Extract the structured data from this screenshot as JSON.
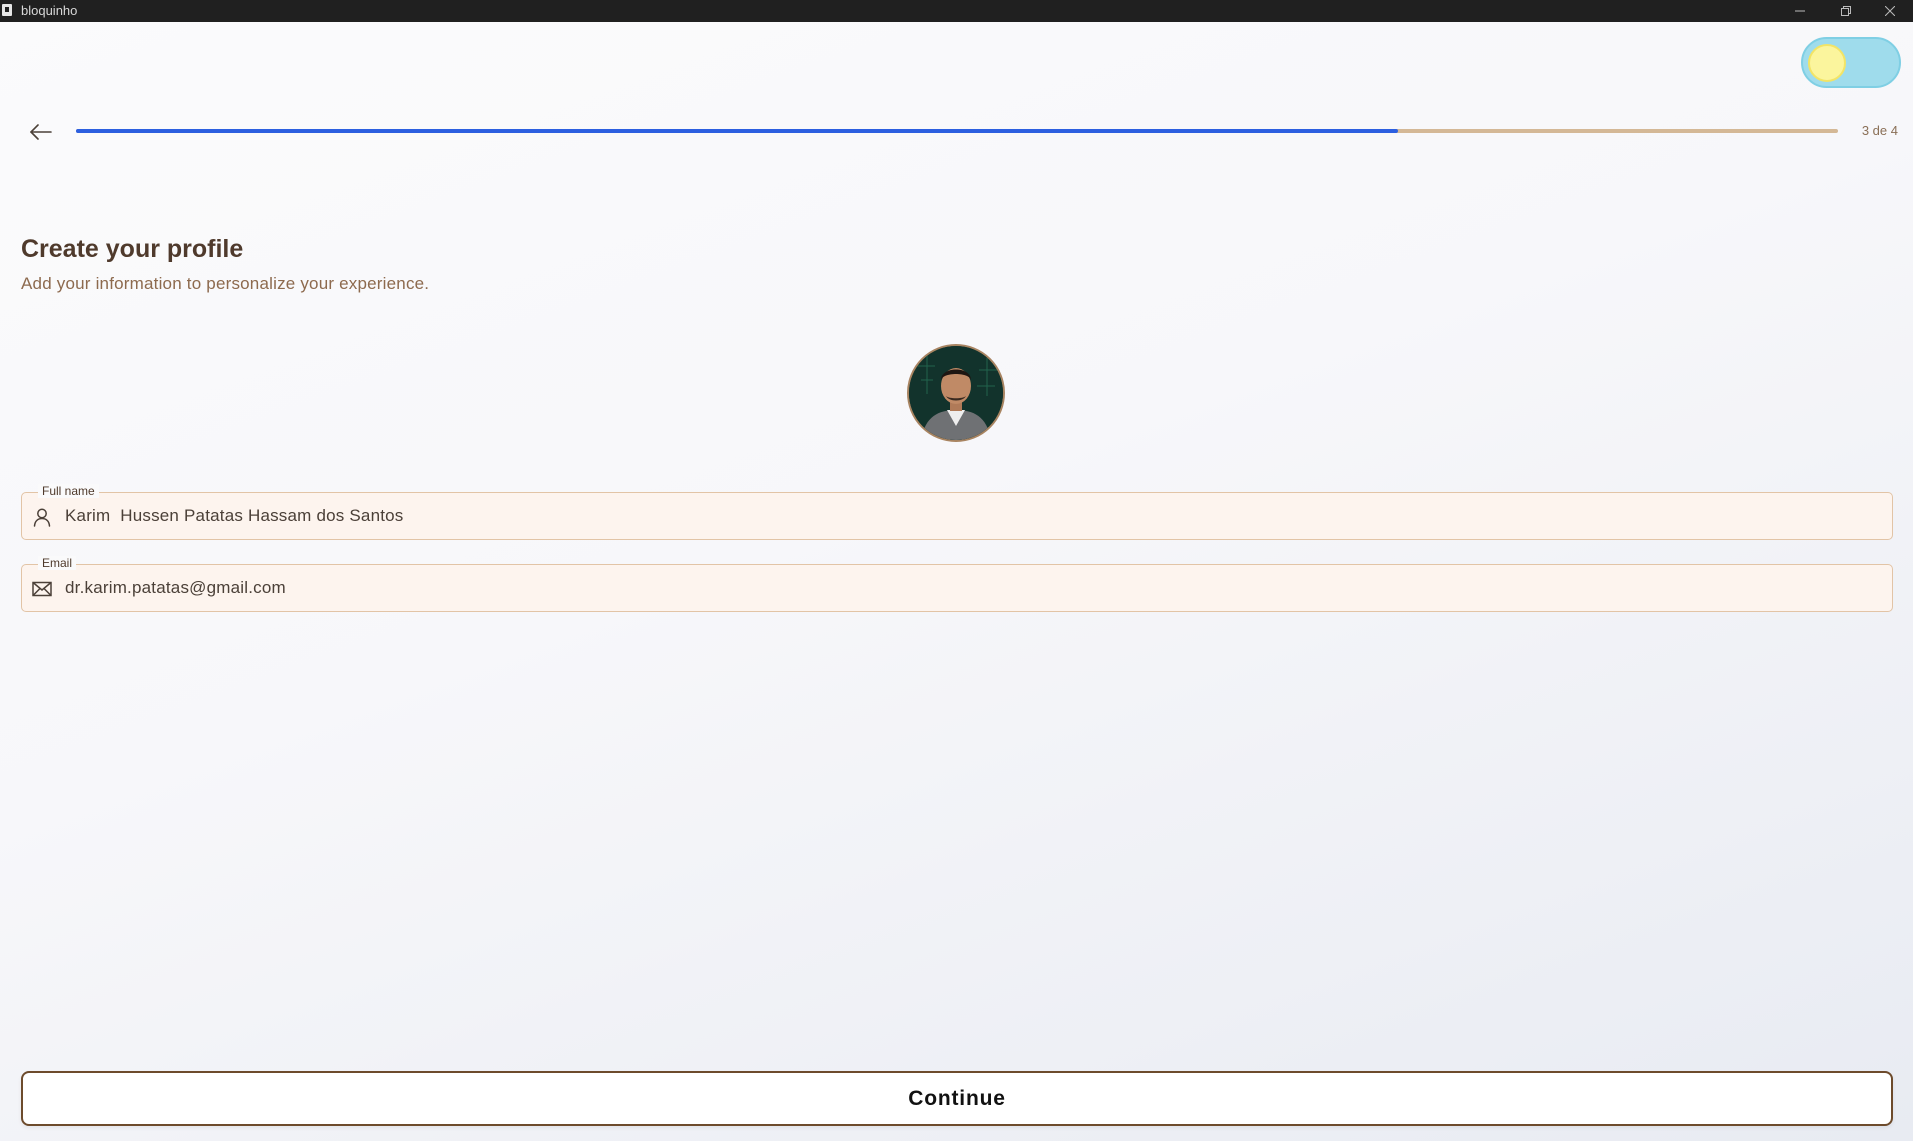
{
  "window": {
    "title": "bloquinho"
  },
  "progress": {
    "current_step": 3,
    "total_steps": 4,
    "fraction": 0.75,
    "label": "3 de 4"
  },
  "header": {
    "title": "Create your profile",
    "subtitle": "Add your information to personalize your experience."
  },
  "form": {
    "full_name": {
      "label": "Full name",
      "value": "Karim  Hussen Patatas Hassam dos Santos",
      "icon": "user-icon"
    },
    "email": {
      "label": "Email",
      "value": "dr.karim.patatas@gmail.com",
      "icon": "mail-icon"
    }
  },
  "actions": {
    "continue_label": "Continue"
  },
  "theme_toggle": {
    "mode": "light",
    "icon": "sun-icon"
  },
  "colors": {
    "accent": "#2c5fe0",
    "track": "#d4b896",
    "title": "#4f3a2c",
    "subtitle": "#8d6a4e",
    "field_bg": "#fdf4ee",
    "field_border": "#e2c4a6",
    "button_border": "#6d4b2c"
  }
}
